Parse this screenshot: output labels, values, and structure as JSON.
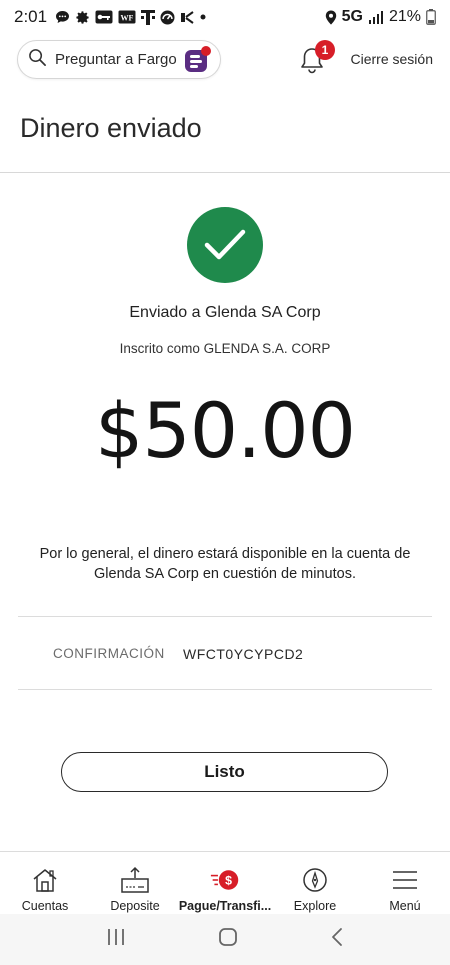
{
  "status_bar": {
    "time": "2:01",
    "network": "5G",
    "battery": "21%",
    "icons": [
      "chat-icon",
      "settings-icon",
      "key-icon",
      "wf-icon",
      "tmobile-icon",
      "speedometer-icon",
      "signal-box-icon",
      "dot-icon",
      "location-icon",
      "signal-bars-icon",
      "battery-icon"
    ],
    "wf_text": "WF"
  },
  "header": {
    "search_label": "Preguntar a Fargo",
    "notification_count": "1",
    "signout_label": "Cierre sesión"
  },
  "page": {
    "title": "Dinero enviado",
    "sent_to": "Enviado a Glenda SA Corp",
    "enrolled_as": "Inscrito como GLENDA S.A. CORP",
    "amount": "$50.00",
    "availability": "Por lo general, el dinero estará disponible en la cuenta de Glenda SA Corp en cuestión de minutos.",
    "confirmation_label": "CONFIRMACIÓN",
    "confirmation_number": "WFCT0YCYPCD2",
    "done_label": "Listo"
  },
  "bottom_nav": [
    {
      "label": "Cuentas",
      "icon": "home-icon"
    },
    {
      "label": "Deposite",
      "icon": "deposit-icon"
    },
    {
      "label": "Pague/Transfi...",
      "icon": "pay-transfer-icon",
      "active": true
    },
    {
      "label": "Explore",
      "icon": "compass-icon"
    },
    {
      "label": "Menú",
      "icon": "menu-icon"
    }
  ],
  "colors": {
    "success_green": "#1f8a4c",
    "brand_red": "#d71e28",
    "fargo_purple": "#5a2d82"
  }
}
